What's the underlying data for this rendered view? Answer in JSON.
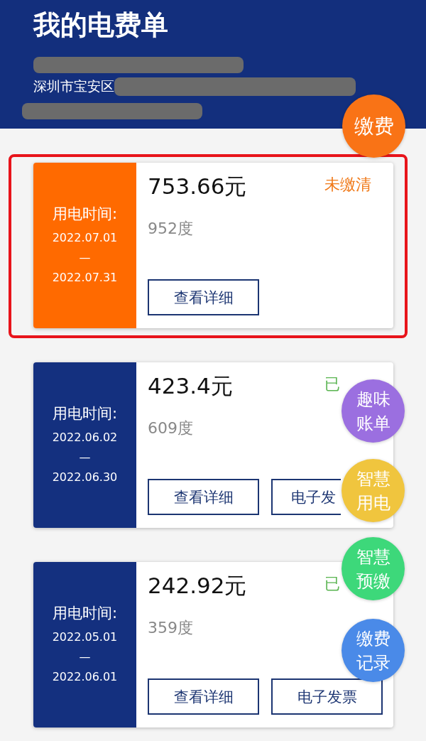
{
  "header": {
    "title": "我的电费单",
    "address": "深圳市宝安区"
  },
  "bills": [
    {
      "paid": false,
      "highlighted": true,
      "period_label": "用电时间:",
      "start": "2022.07.01",
      "separator": "—",
      "end": "2022.07.31",
      "amount": "753.66元",
      "usage": "952度",
      "status_text": "未缴清",
      "buttons": [
        {
          "label": "查看详细",
          "covered": false
        }
      ]
    },
    {
      "paid": true,
      "highlighted": false,
      "period_label": "用电时间:",
      "start": "2022.06.02",
      "separator": "—",
      "end": "2022.06.30",
      "amount": "423.4元",
      "usage": "609度",
      "status_text": "已",
      "buttons": [
        {
          "label": "查看详细",
          "covered": false
        },
        {
          "label": "电子发",
          "covered": true
        }
      ]
    },
    {
      "paid": true,
      "highlighted": false,
      "period_label": "用电时间:",
      "start": "2022.05.01",
      "separator": "—",
      "end": "2022.06.01",
      "amount": "242.92元",
      "usage": "359度",
      "status_text": "已",
      "buttons": [
        {
          "label": "查看详细",
          "covered": false
        },
        {
          "label": "电子发票",
          "covered": false
        }
      ]
    }
  ],
  "floating_buttons": [
    {
      "label": "缴费",
      "color": "#f97316"
    },
    {
      "label": "趣味账单",
      "color": "#9b6fe0"
    },
    {
      "label": "智慧用电",
      "color": "#f0c53e"
    },
    {
      "label": "智慧预缴",
      "color": "#3dd87a"
    },
    {
      "label": "缴费记录",
      "color": "#4a8ae8"
    }
  ]
}
